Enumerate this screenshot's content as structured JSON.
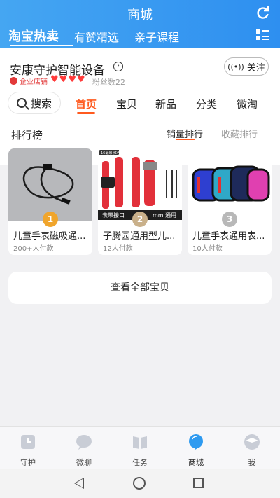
{
  "header": {
    "title": "商城",
    "tabs": [
      "淘宝热卖",
      "有赞精选",
      "亲子课程"
    ],
    "active_tab": "淘宝热卖"
  },
  "shop": {
    "name": "安康守护智能设备",
    "enterprise_label": "企业店铺",
    "hearts": 4,
    "fans": "粉丝数22",
    "follow_label": "关注",
    "search_label": "搜索",
    "tabs": [
      "首页",
      "宝贝",
      "新品",
      "分类",
      "微淘"
    ],
    "active_tab": "首页"
  },
  "ranking": {
    "title": "排行榜",
    "sort_sales": "销量排行",
    "sort_fav": "收藏排行",
    "items": [
      {
        "rank": "1",
        "name": "儿童手表磁吸通...",
        "sold": "200+人付款",
        "badge_color": "#f0a52c"
      },
      {
        "rank": "2",
        "name": "子腾园通用型儿...",
        "sold": "12人付款",
        "badge_color": "#c9b08a"
      },
      {
        "rank": "3",
        "name": "儿童手表通用表...",
        "sold": "10人付款",
        "badge_color": "#b8b8b8"
      }
    ],
    "img2_caption": "表带接口",
    "img2_caption2": "mm 通用",
    "img2_tag": "16毫米 红色"
  },
  "view_all_label": "查看全部宝贝",
  "bottom_nav": [
    "守护",
    "微聊",
    "任务",
    "商城",
    "我"
  ],
  "active_nav": "商城",
  "colors": {
    "accent": "#ff5a1f",
    "header": "#2e8ff0"
  }
}
